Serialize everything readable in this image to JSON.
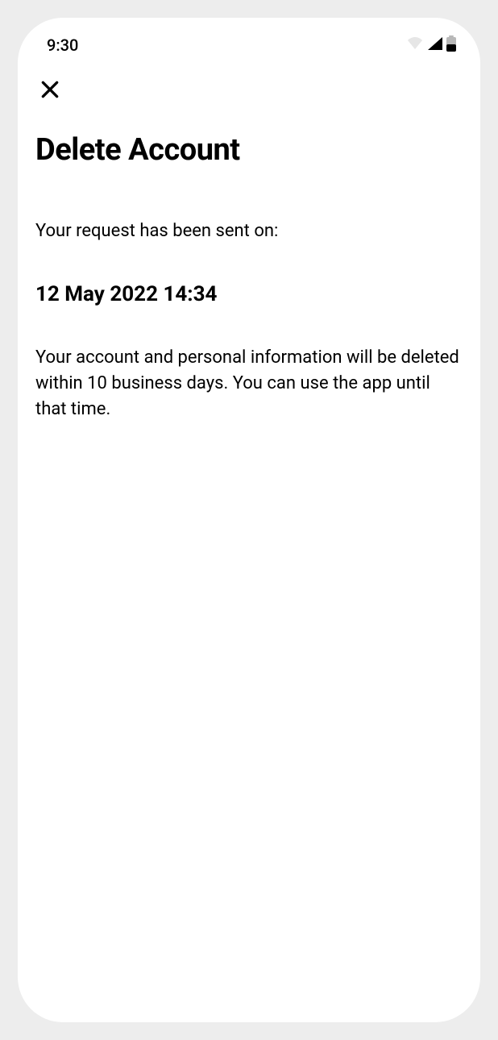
{
  "status": {
    "time": "9:30"
  },
  "header": {
    "title": "Delete Account"
  },
  "content": {
    "intro": "Your request has been sent on:",
    "timestamp": "12 May 2022 14:34",
    "body": "Your account and personal information will be deleted within 10 business days. You can use the app until that time."
  }
}
